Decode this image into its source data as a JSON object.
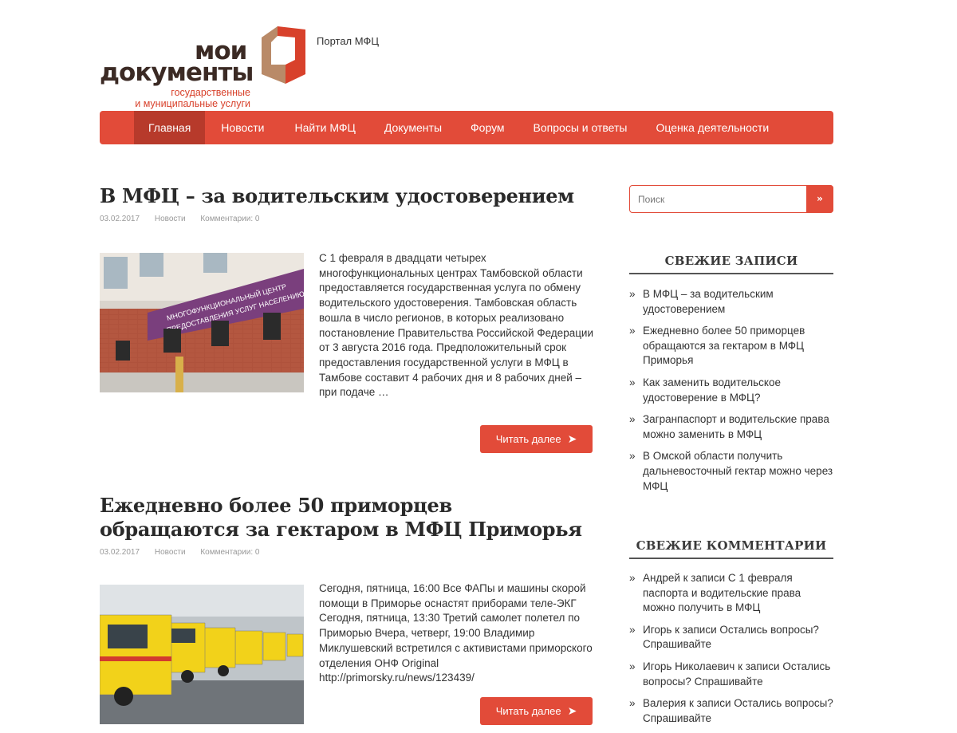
{
  "header": {
    "logo_line1": "мои",
    "logo_line2": "документы",
    "logo_sub1": "государственные",
    "logo_sub2": "и муниципальные услуги",
    "site_description": "Портал МФЦ"
  },
  "nav": {
    "items": [
      "Главная",
      "Новости",
      "Найти МФЦ",
      "Документы",
      "Форум",
      "Вопросы и ответы",
      "Оценка деятельности"
    ],
    "active_index": 0
  },
  "posts": [
    {
      "title": "В МФЦ – за водительским удостоверением",
      "date": "03.02.2017",
      "category": "Новости",
      "comments": "Комментарии: 0",
      "excerpt": "С 1 февраля в двадцати четырех многофункциональных центрах Тамбовской области предоставляется государственная услуга по обмену водительского удостоверения. Тамбовская область вошла в число регионов, в которых реализовано постановление Правительства Российской Федерации от 3 августа 2016 года.  Предположительный срок предоставления государственной услуги в МФЦ в Тамбове составит 4 рабочих дня и 8 рабочих дней – при подаче …",
      "read_more": "Читать далее",
      "image_sign_line1": "МНОГОФУНКЦИОНАЛЬНЫЙ ЦЕНТР",
      "image_sign_line2": "ПРЕДОСТАВЛЕНИЯ УСЛУГ НАСЕЛЕНИЮ"
    },
    {
      "title": "Ежедневно более 50 приморцев обращаются за гектаром в МФЦ Приморья",
      "date": "03.02.2017",
      "category": "Новости",
      "comments": "Комментарии: 0",
      "excerpt": "Сегодня, пятница, 16:00 Все ФАПы и машины скорой помощи в Приморье оснастят приборами теле-ЭКГ Сегодня, пятница, 13:30 Третий самолет полетел по Приморью Вчера, четверг, 19:00 Владимир Миклушевский встретился с активистами приморского отделения ОНФ Original http://primorsky.ru/news/123439/",
      "read_more": "Читать далее"
    }
  ],
  "sidebar": {
    "search_placeholder": "Поиск",
    "search_button": "»",
    "recent_posts_title": "Свежие записи",
    "recent_posts": [
      "В МФЦ – за водительским удостоверением",
      "Ежедневно более 50 приморцев обращаются за гектаром в МФЦ Приморья",
      "Как заменить водительское удостоверение в МФЦ?",
      "Загранпаспорт и водительские права можно заменить в МФЦ",
      "В Омской области получить дальневосточный гектар можно через МФЦ"
    ],
    "recent_comments_title": "Свежие комментарии",
    "recent_comments": [
      "Андрей к записи С 1 февраля паспорта и водительские права можно получить в МФЦ",
      "Игорь к записи Остались вопросы? Спрашивайте",
      "Игорь Николаевич к записи Остались вопросы? Спрашивайте",
      "Валерия к записи Остались вопросы? Спрашивайте"
    ]
  },
  "colors": {
    "accent": "#e24b39",
    "accent_dark": "#b73a2b",
    "logo_brown": "#3b2a24"
  }
}
